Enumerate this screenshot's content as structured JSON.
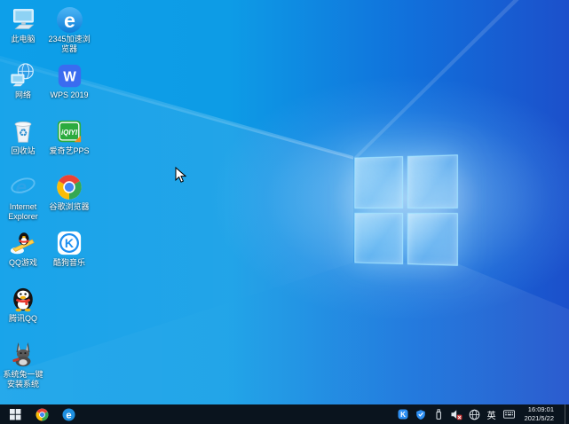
{
  "wallpaper": {
    "base_left": "#0D9FE9",
    "base_right": "#1C50CB",
    "logo_edge": "#A5E6FF",
    "taskbar_bg": "#0A141E"
  },
  "desktop": {
    "icons": [
      {
        "id": "this-pc",
        "label": "此电脑"
      },
      {
        "id": "2345-browser",
        "label": "2345加速浏览器",
        "glyph": "e"
      },
      {
        "id": "network",
        "label": "网络"
      },
      {
        "id": "wps-2019",
        "label": "WPS 2019",
        "glyph": "W"
      },
      {
        "id": "recycle-bin",
        "label": "回收站",
        "glyph": "♻"
      },
      {
        "id": "iqiyi-pps",
        "label": "爱奇艺PPS",
        "glyph": "iQIYI"
      },
      {
        "id": "internet-explorer",
        "label": "Internet Explorer",
        "glyph": "e"
      },
      {
        "id": "chrome",
        "label": "谷歌浏览器"
      },
      {
        "id": "qq-games",
        "label": "QQ游戏"
      },
      {
        "id": "kugou-music",
        "label": "酷狗音乐",
        "glyph": "K"
      },
      {
        "id": "tencent-qq",
        "label": "腾讯QQ"
      },
      {
        "id": "system-rabbit",
        "label": "系统兔一键安装系统"
      }
    ]
  },
  "taskbar": {
    "pinned": [
      {
        "id": "start",
        "name": "start-button"
      },
      {
        "id": "chrome",
        "name": "chrome-taskbar"
      },
      {
        "id": "2345-browser",
        "name": "2345-browser-taskbar",
        "glyph": "e"
      }
    ],
    "tray": {
      "kugou_glyph": "K",
      "ime": "英",
      "time": "16:09:01",
      "date": "2021/5/22"
    }
  }
}
